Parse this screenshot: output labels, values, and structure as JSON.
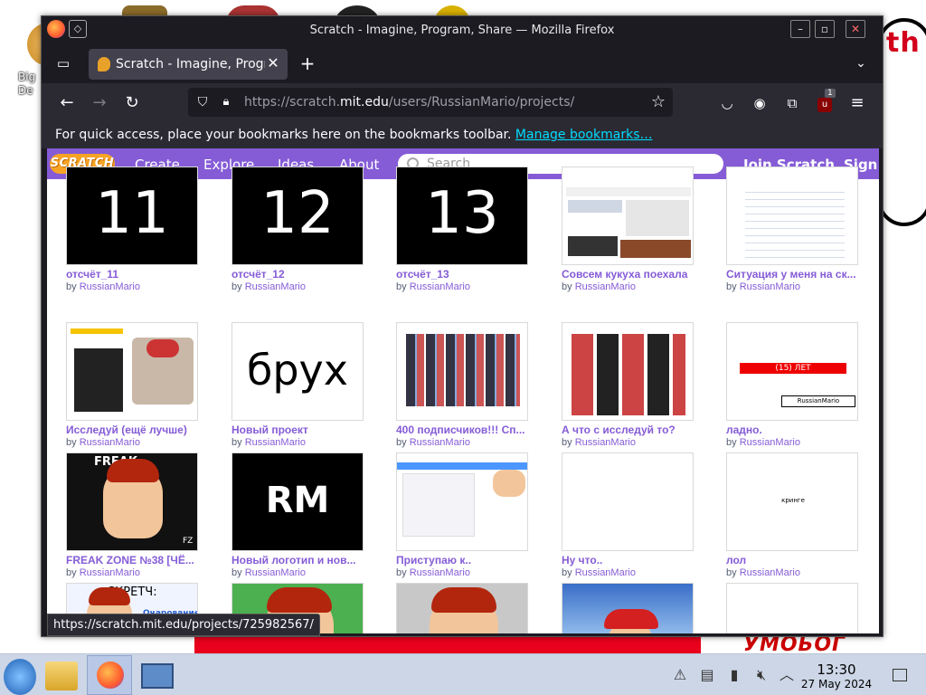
{
  "window": {
    "title": "Scratch - Imagine, Program, Share — Mozilla Firefox",
    "tab_title": "Scratch - Imagine, Progra",
    "url_prefix": "https://scratch.",
    "url_domain": "mit.edu",
    "url_suffix": "/users/RussianMario/projects/",
    "bookmarks_text": "For quick access, place your bookmarks here on the bookmarks toolbar.",
    "bookmarks_link": "Manage bookmarks…",
    "status_url": "https://scratch.mit.edu/projects/725982567/",
    "extension_badge": "1"
  },
  "desktop": {
    "label": "Big\nDe",
    "wall_text_1": "this is totally",
    "wall_text_2": "УМОЬОГ"
  },
  "scratch": {
    "logo": "SCRATCH",
    "nav": [
      "Create",
      "Explore",
      "Ideas",
      "About"
    ],
    "search_placeholder": "Search",
    "join": "Join Scratch",
    "signin": "Sign i"
  },
  "projects": [
    {
      "title": "отсчёт_11",
      "author": "RussianMario",
      "thumb_text": "11"
    },
    {
      "title": "отсчёт_12",
      "author": "RussianMario",
      "thumb_text": "12"
    },
    {
      "title": "отсчёт_13",
      "author": "RussianMario",
      "thumb_text": "13"
    },
    {
      "title": "Совсем кукуха поехала",
      "author": "RussianMario"
    },
    {
      "title": "Ситуация у меня на ск...",
      "author": "RussianMario"
    },
    {
      "title": "Исследуй (ещё лучше)",
      "author": "RussianMario"
    },
    {
      "title": "Новый проект",
      "author": "RussianMario",
      "thumb_text": "брух"
    },
    {
      "title": "400 подписчиков!!! Сп...",
      "author": "RussianMario"
    },
    {
      "title": "А что с исследуй то?",
      "author": "RussianMario"
    },
    {
      "title": "ладно.",
      "author": "RussianMario",
      "thumb_text": "(15) ЛЕТ",
      "thumb_sub": "RussianMario"
    },
    {
      "title": "FREAK ZONE №38 [ЧЁ...",
      "author": "RussianMario",
      "thumb_text": "FREAK",
      "thumb_sub": "FZ"
    },
    {
      "title": "Новый логотип и нов...",
      "author": "RussianMario",
      "thumb_text": "RM"
    },
    {
      "title": "Приступаю к..",
      "author": "RussianMario"
    },
    {
      "title": "Ну что..",
      "author": "RussianMario"
    },
    {
      "title": "лол",
      "author": "RussianMario",
      "thumb_text": "кринге"
    }
  ],
  "partial_row": {
    "text_1": "СКРЕТЧ:",
    "text_2": "Очарование"
  },
  "by_label": "by",
  "clock": {
    "time": "13:30",
    "date": "27 May 2024"
  }
}
